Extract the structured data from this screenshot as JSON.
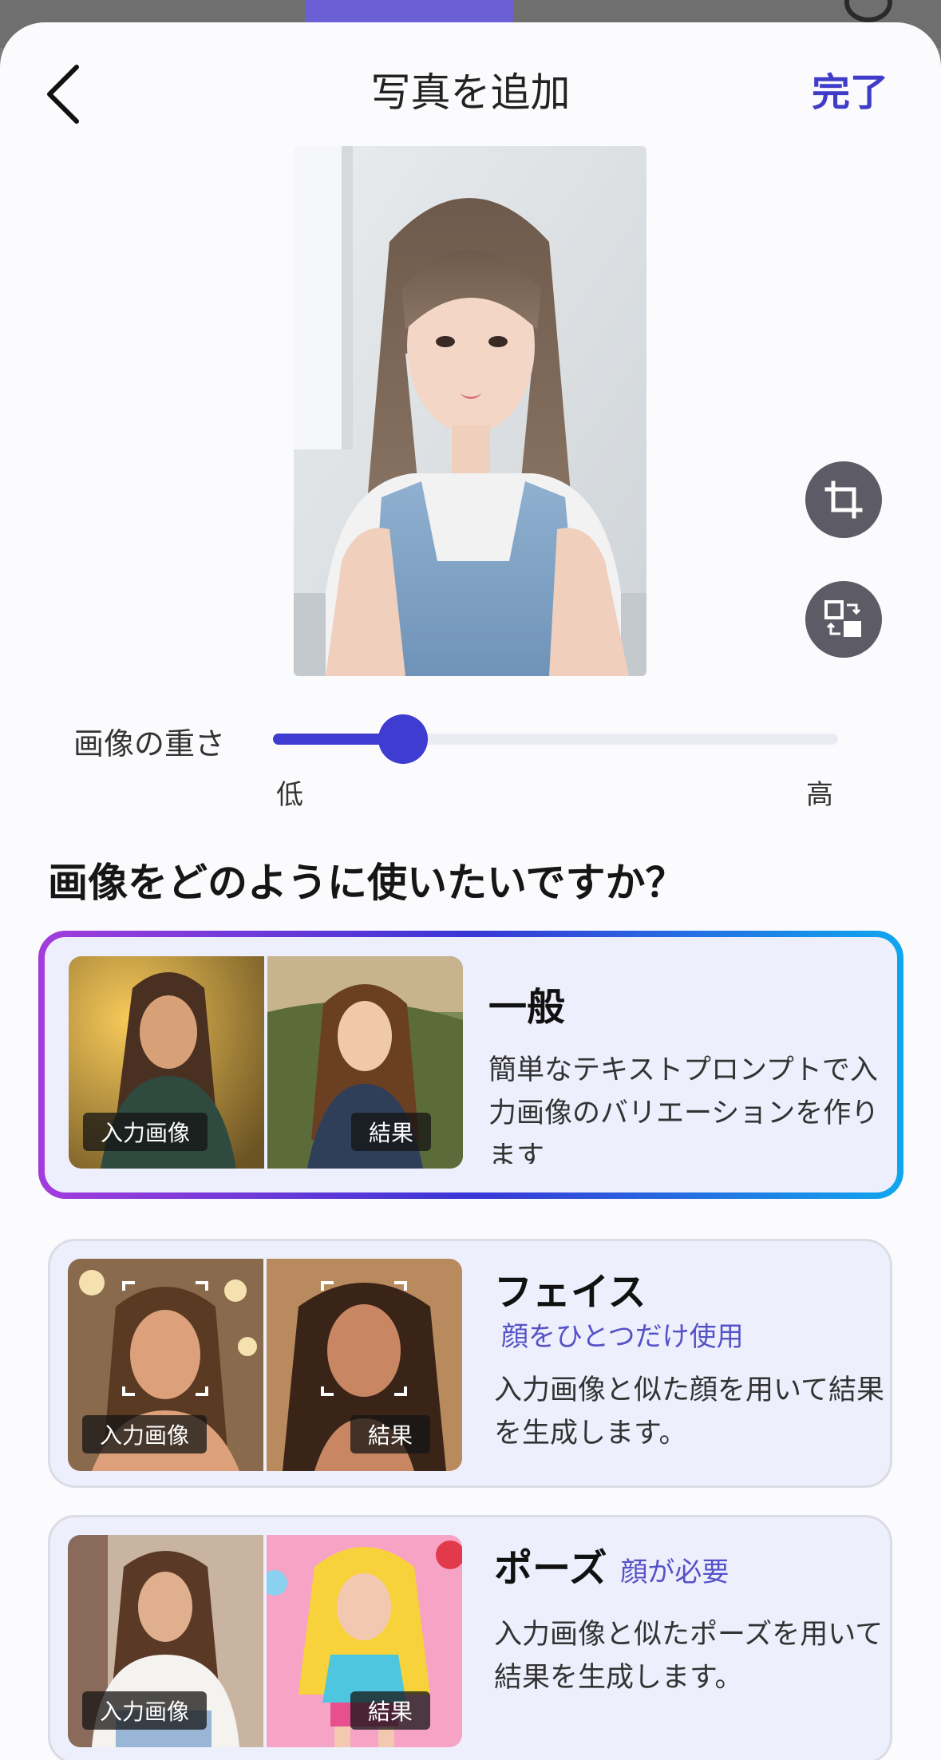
{
  "header": {
    "title": "写真を追加",
    "done_label": "完了",
    "back_icon": "chevron-left-icon"
  },
  "tools": {
    "crop_icon": "crop-icon",
    "swap_icon": "swap-photo-icon"
  },
  "slider": {
    "label": "画像の重さ",
    "min_label": "低",
    "max_label": "高",
    "value": 0.23,
    "accent": "#3f3cd2"
  },
  "question": "画像をどのように使いたいですか？",
  "options": [
    {
      "title": "一般",
      "subtitle": "",
      "description": "簡単なテキストプロンプトで入力画像のバリエーションを作ります",
      "input_tag": "入力画像",
      "result_tag": "結果",
      "selected": true
    },
    {
      "title": "フェイス",
      "subtitle": "顔をひとつだけ使用",
      "description": "入力画像と似た顔を用いて結果を生成します。",
      "input_tag": "入力画像",
      "result_tag": "結果",
      "selected": false
    },
    {
      "title": "ポーズ",
      "subtitle": "顔が必要",
      "description": "入力画像と似たポーズを用いて結果を生成します。",
      "input_tag": "入力画像",
      "result_tag": "結果",
      "selected": false
    }
  ],
  "colors": {
    "accent": "#3f3cc8",
    "card_bg": "#eeeffc",
    "gradient": [
      "#a23ddc",
      "#3a36d6",
      "#10a7ee"
    ]
  }
}
